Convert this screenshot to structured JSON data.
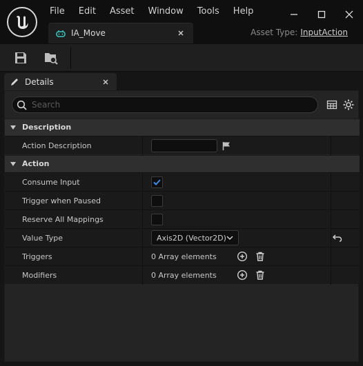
{
  "menu": {
    "items": [
      "File",
      "Edit",
      "Asset",
      "Window",
      "Tools",
      "Help"
    ]
  },
  "tab": {
    "label": "IA_Move"
  },
  "asset_type": {
    "label": "Asset Type:",
    "value": "InputAction"
  },
  "details": {
    "tab_label": "Details",
    "search_placeholder": "Search"
  },
  "categories": [
    {
      "label": "Description",
      "properties": [
        {
          "label": "Action Description",
          "value": ""
        }
      ]
    },
    {
      "label": "Action",
      "properties": [
        {
          "label": "Consume Input",
          "checked": true
        },
        {
          "label": "Trigger when Paused",
          "checked": false
        },
        {
          "label": "Reserve All Mappings",
          "checked": false
        },
        {
          "label": "Value Type",
          "value": "Axis2D (Vector2D)"
        },
        {
          "label": "Triggers",
          "value": "0 Array elements"
        },
        {
          "label": "Modifiers",
          "value": "0 Array elements"
        }
      ]
    }
  ],
  "colors": {
    "accent": "#4a90e2",
    "checkmark": "#3d8be5",
    "tab_icon": "#3cc6c0"
  },
  "icons": {
    "logo": "unreal-engine-logo",
    "tab_icon": "input-action-icon",
    "save": "save-icon",
    "browse": "browse-asset-icon",
    "details": "pencil-icon",
    "search": "search-icon",
    "table": "table-view-icon",
    "settings": "gear-icon",
    "flag": "flag-icon",
    "add": "plus-circle-icon",
    "delete": "trash-icon",
    "reset": "reset-to-default-icon"
  }
}
